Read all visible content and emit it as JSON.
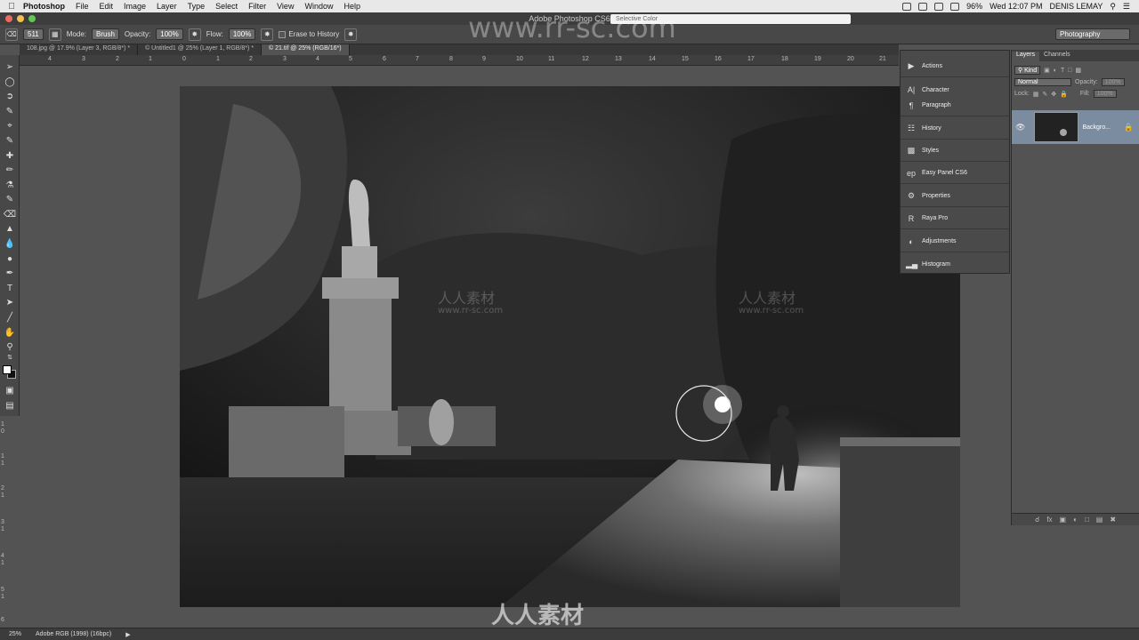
{
  "menubar": {
    "app_name": "Photoshop",
    "items": [
      "File",
      "Edit",
      "Image",
      "Layer",
      "Type",
      "Select",
      "Filter",
      "View",
      "Window",
      "Help"
    ],
    "battery": "96%",
    "clock": "Wed 12:07 PM",
    "user": "DENIS LEMAY"
  },
  "window": {
    "title": "Adobe Photoshop CS6",
    "url_box": "Selective Color"
  },
  "options_bar": {
    "brush_size": "511",
    "mode_label": "Mode:",
    "mode_value": "Brush",
    "opacity_label": "Opacity:",
    "opacity_value": "100%",
    "flow_label": "Flow:",
    "flow_value": "100%",
    "erase_history_label": "Erase to History",
    "workspace": "Photography"
  },
  "doc_tabs": [
    {
      "label": "108.jpg @ 17.9% (Layer 3, RGB/8*) *"
    },
    {
      "label": "© Untitled1 @ 25% (Layer 1, RGB/8*) *"
    },
    {
      "label": "© 21.tif @ 25% (RGB/16*)"
    }
  ],
  "ruler": {
    "h_ticks": [
      "4",
      "3",
      "2",
      "1",
      "0",
      "1",
      "2",
      "3",
      "4",
      "5",
      "6",
      "7",
      "8",
      "9",
      "10",
      "11",
      "12",
      "13",
      "14",
      "15",
      "16",
      "17",
      "18",
      "19",
      "20",
      "21"
    ],
    "v_ticks": [
      "1",
      "0",
      "1",
      "1",
      "2",
      "1",
      "3",
      "1",
      "4",
      "1",
      "5",
      "1",
      "6"
    ]
  },
  "dock_panels": [
    {
      "label": "Actions",
      "icon": "play-icon"
    },
    {
      "label": "Character",
      "icon": "character-icon"
    },
    {
      "label": "Paragraph",
      "icon": "paragraph-icon"
    },
    {
      "label": "History",
      "icon": "history-icon"
    },
    {
      "label": "Styles",
      "icon": "styles-icon"
    },
    {
      "label": "Easy Panel CS6",
      "icon": "ep-icon"
    },
    {
      "label": "Properties",
      "icon": "properties-icon"
    },
    {
      "label": "Raya Pro",
      "icon": "raya-icon"
    },
    {
      "label": "Adjustments",
      "icon": "adjustments-icon"
    },
    {
      "label": "Histogram",
      "icon": "histogram-icon"
    }
  ],
  "layers_panel": {
    "tabs": [
      "Layers",
      "Channels"
    ],
    "filter_kind": "Kind",
    "blend_mode": "Normal",
    "opacity_label": "Opacity:",
    "opacity_value": "100%",
    "lock_label": "Lock:",
    "fill_label": "Fill:",
    "fill_value": "100%",
    "layer_name": "Backgro..."
  },
  "status": {
    "zoom": "25%",
    "profile": "Adobe RGB (1998) (16bpc)"
  },
  "watermarks": {
    "top": "www.rr-sc.com",
    "bottom": "人人素材",
    "center1": "人人素材",
    "center2": "www.rr-sc.com"
  },
  "colors": {
    "accent": "#7b8ba0",
    "menubar": "#e8e8e8",
    "panel": "#535353"
  }
}
